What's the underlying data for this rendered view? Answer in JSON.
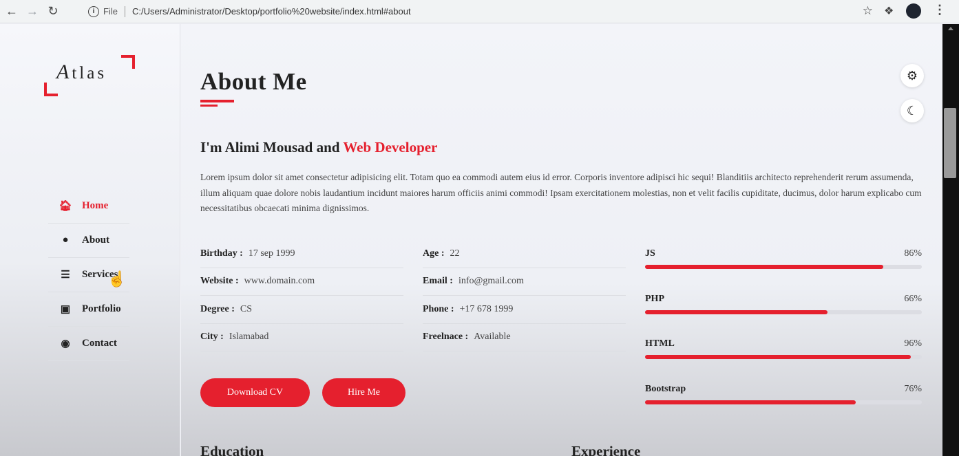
{
  "browser": {
    "back_icon": "arrow-left-icon",
    "forward_icon": "arrow-right-icon",
    "reload_icon": "reload-icon",
    "scheme_label": "File",
    "url": "C:/Users/Administrator/Desktop/portfolio%20website/index.html#about"
  },
  "sidebar": {
    "logo_first": "A",
    "logo_rest": "tlas",
    "items": [
      {
        "label": "Home",
        "icon": "home-icon",
        "active": true
      },
      {
        "label": "About",
        "icon": "user-icon",
        "active": false
      },
      {
        "label": "Services",
        "icon": "list-icon",
        "active": false
      },
      {
        "label": "Portfolio",
        "icon": "briefcase-icon",
        "active": false
      },
      {
        "label": "Contact",
        "icon": "chat-icon",
        "active": false
      }
    ]
  },
  "main": {
    "title": "About Me",
    "headline_prefix": "I'm Alimi Mousad and ",
    "headline_accent": "Web Developer",
    "bio": "Lorem ipsum dolor sit amet consectetur adipisicing elit. Totam quo ea commodi autem eius id error. Corporis inventore adipisci hic sequi! Blanditiis architecto reprehenderit rerum assumenda, illum aliquam quae dolore nobis laudantium incidunt maiores harum officiis animi commodi! Ipsam exercitationem molestias, non et velit facilis cupiditate, ducimus, dolor harum explicabo cum necessitatibus obcaecati minima dignissimos.",
    "info_left": [
      {
        "key": "Birthday :",
        "value": "17 sep 1999"
      },
      {
        "key": "Website :",
        "value": "www.domain.com"
      },
      {
        "key": "Degree :",
        "value": "CS"
      },
      {
        "key": "City :",
        "value": "Islamabad"
      }
    ],
    "info_right": [
      {
        "key": "Age :",
        "value": "22"
      },
      {
        "key": "Email :",
        "value": "info@gmail.com"
      },
      {
        "key": "Phone :",
        "value": "+17 678 1999"
      },
      {
        "key": "Freelnace :",
        "value": "Available"
      }
    ],
    "skills": [
      {
        "name": "JS",
        "percent_label": "86%",
        "level": 0.86
      },
      {
        "name": "PHP",
        "percent_label": "66%",
        "level": 0.66
      },
      {
        "name": "HTML",
        "percent_label": "96%",
        "level": 0.96
      },
      {
        "name": "Bootstrap",
        "percent_label": "76%",
        "level": 0.76
      }
    ],
    "download_cv_label": "Download CV",
    "hire_me_label": "Hire Me",
    "education_title": "Education",
    "experience_title": "Experience"
  },
  "floating": {
    "settings_icon": "gear-icon",
    "theme_icon": "moon-icon"
  },
  "colors": {
    "accent": "#e5202e",
    "text": "#222222",
    "background": "#f2f3f8"
  }
}
